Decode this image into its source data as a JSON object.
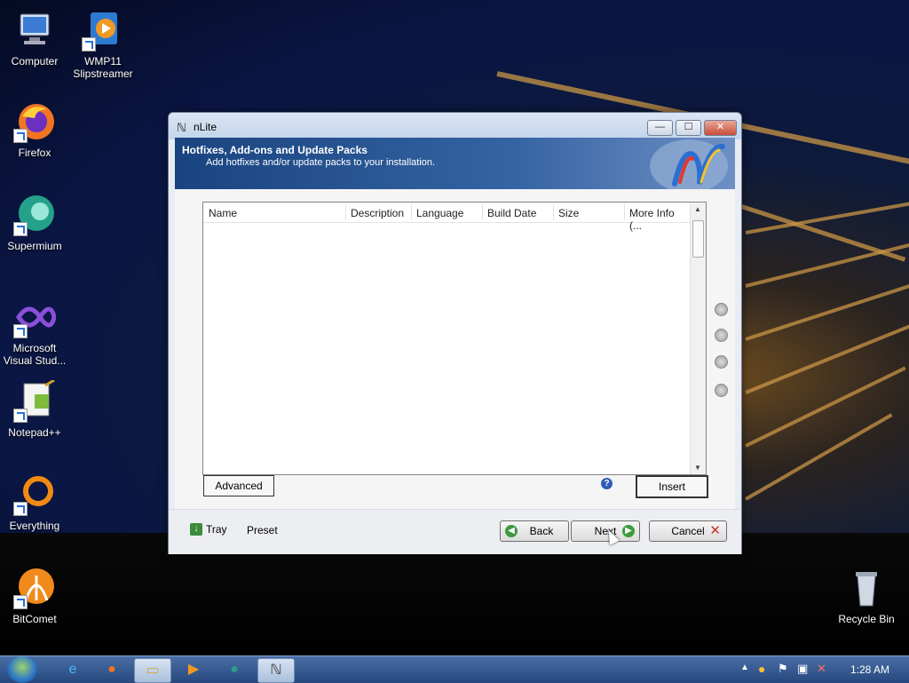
{
  "desktop": {
    "icons": [
      {
        "label": "Computer",
        "icon": "computer-icon"
      },
      {
        "label": "WMP11 Slipstreamer",
        "icon": "media-player-icon"
      },
      {
        "label": "Firefox",
        "icon": "firefox-icon"
      },
      {
        "label": "Supermium",
        "icon": "supermium-icon"
      },
      {
        "label": "Microsoft Visual Stud...",
        "icon": "visual-studio-icon"
      },
      {
        "label": "Notepad++",
        "icon": "notepadpp-icon"
      },
      {
        "label": "Everything",
        "icon": "everything-icon"
      },
      {
        "label": "BitComet",
        "icon": "bitcomet-icon"
      },
      {
        "label": "Recycle Bin",
        "icon": "recycle-bin-icon"
      }
    ]
  },
  "window": {
    "title": "nLite",
    "controls": {
      "minimize": "—",
      "maximize": "☐",
      "close": "✕"
    },
    "banner": {
      "title": "Hotfixes, Add-ons and Update Packs",
      "subtitle": "Add hotfixes and/or update packs to your installation."
    },
    "list": {
      "columns": [
        "Name",
        "Description",
        "Language",
        "Build Date",
        "Size",
        "More Info (..."
      ],
      "rows": []
    },
    "buttons": {
      "advanced": "Advanced",
      "insert": "Insert",
      "help": "?",
      "tray": "Tray",
      "preset": "Preset",
      "back": "Back",
      "next": "Next",
      "cancel": "Cancel"
    }
  },
  "taskbar": {
    "clock": "1:28 AM"
  },
  "colors": {
    "banner": "#19447f",
    "taskbar": "#25477d",
    "accent_green": "#3d9b3d",
    "cancel_red": "#c8312a"
  }
}
